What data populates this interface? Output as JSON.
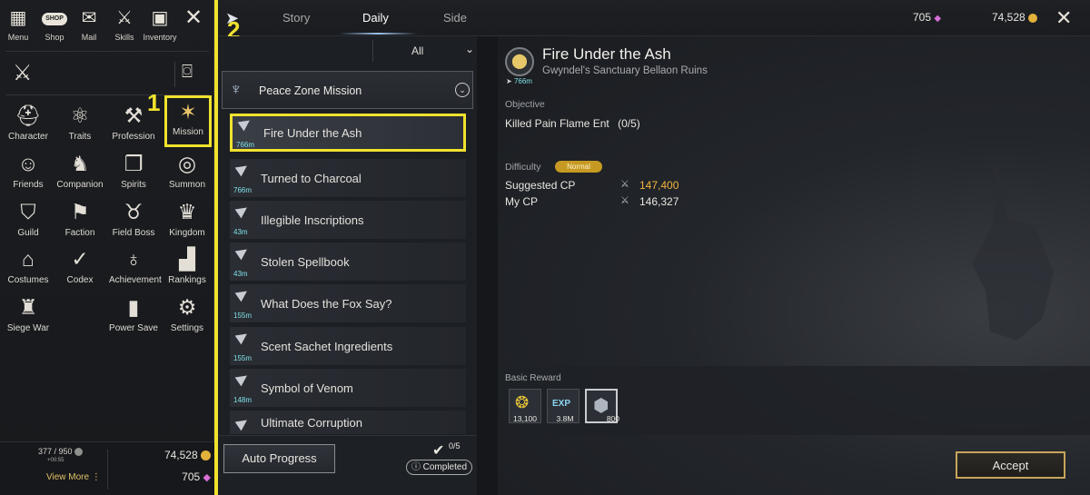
{
  "menu": {
    "top": [
      {
        "label": "Menu",
        "icon": "grid-icon"
      },
      {
        "label": "Shop",
        "icon": "shop-icon",
        "badge": "SHOP"
      },
      {
        "label": "Mail",
        "icon": "mail-icon"
      },
      {
        "label": "Skills",
        "icon": "skills-icon"
      },
      {
        "label": "Inventory",
        "icon": "inventory-icon"
      }
    ],
    "grid": [
      {
        "label": "Character",
        "icon": "character-icon"
      },
      {
        "label": "Traits",
        "icon": "traits-icon"
      },
      {
        "label": "Profession",
        "icon": "profession-icon"
      },
      {
        "label": "Mission",
        "icon": "mission-icon"
      },
      {
        "label": "Friends",
        "icon": "friends-icon"
      },
      {
        "label": "Companion",
        "icon": "companion-icon"
      },
      {
        "label": "Spirits",
        "icon": "spirits-icon"
      },
      {
        "label": "Summon",
        "icon": "summon-icon"
      },
      {
        "label": "Guild",
        "icon": "guild-icon"
      },
      {
        "label": "Faction",
        "icon": "faction-icon"
      },
      {
        "label": "Field Boss",
        "icon": "field-boss-icon"
      },
      {
        "label": "Kingdom",
        "icon": "kingdom-icon"
      },
      {
        "label": "Costumes",
        "icon": "costumes-icon"
      },
      {
        "label": "Codex",
        "icon": "codex-icon"
      },
      {
        "label": "Achievement",
        "icon": "achievement-icon"
      },
      {
        "label": "Rankings",
        "icon": "rankings-icon"
      },
      {
        "label": "Siege War",
        "icon": "siege-war-icon"
      },
      {
        "label": "Power Save",
        "icon": "power-save-icon"
      },
      {
        "label": "Settings",
        "icon": "settings-icon"
      }
    ],
    "footer": {
      "weight": "377 / 950",
      "weight_sub": "+00:55",
      "view_more": "View More",
      "gold": "74,528",
      "gems": "705"
    }
  },
  "annotations": {
    "one": "1",
    "two": "2"
  },
  "tabs": [
    "Story",
    "Daily",
    "Side"
  ],
  "header": {
    "gems": "705",
    "gold": "74,528"
  },
  "filter": {
    "value": "All"
  },
  "category": {
    "label": "Peace Zone Mission"
  },
  "quests": [
    {
      "title": "Fire Under the Ash",
      "distance": "766m"
    },
    {
      "title": "Turned to Charcoal",
      "distance": "766m"
    },
    {
      "title": "Illegible Inscriptions",
      "distance": "43m"
    },
    {
      "title": "Stolen Spellbook",
      "distance": "43m"
    },
    {
      "title": "What Does the Fox Say?",
      "distance": "155m"
    },
    {
      "title": "Scent Sachet Ingredients",
      "distance": "155m"
    },
    {
      "title": "Symbol of Venom",
      "distance": "148m"
    },
    {
      "title": "Ultimate Corruption",
      "distance": ""
    }
  ],
  "bottom": {
    "auto_progress": "Auto Progress",
    "completed_count": "0/5",
    "completed_label": "Completed"
  },
  "detail": {
    "title": "Fire Under the Ash",
    "location": "Gwyndel's Sanctuary Bellaon Ruins",
    "distance": "766m",
    "objective_label": "Objective",
    "objective_text": "Killed Pain Flame Ent",
    "objective_progress": "(0/5)",
    "difficulty_label": "Difficulty",
    "difficulty_value": "Normal",
    "suggested_cp_label": "Suggested CP",
    "suggested_cp": "147,400",
    "my_cp_label": "My CP",
    "my_cp": "146,327",
    "reward_label": "Basic Reward",
    "rewards": [
      {
        "icon": "gold-coins-icon",
        "amount": "13,100"
      },
      {
        "icon": "exp-icon",
        "badge": "EXP",
        "amount": "3.8M"
      },
      {
        "icon": "crystal-icon",
        "amount": "800"
      }
    ],
    "accept": "Accept"
  },
  "colors": {
    "highlight": "#f0e22d",
    "gold_text": "#f2b640",
    "teal": "#7fe0e8"
  }
}
